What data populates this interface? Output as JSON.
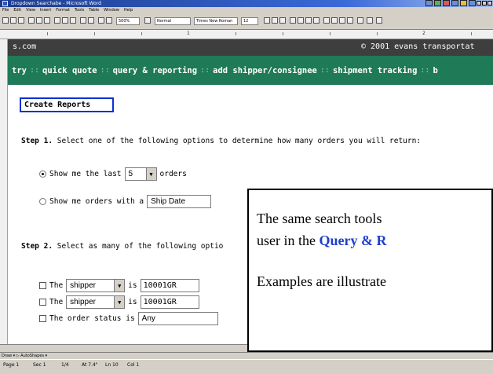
{
  "window": {
    "title": "Dropdown Searchabe - Microsoft Word"
  },
  "menu": [
    "File",
    "Edit",
    "View",
    "Insert",
    "Format",
    "Tools",
    "Table",
    "Window",
    "Help"
  ],
  "toolbar": {
    "zoom": "500%",
    "style": "Normal",
    "font": "Times New Roman",
    "size": "12"
  },
  "ruler": {
    "marks": [
      "1",
      "2"
    ]
  },
  "web": {
    "url": "s.com",
    "copyright": "© 2001 evans transportat",
    "nav_sep": "::",
    "nav": [
      "try",
      "quick quote",
      "query & reporting",
      "add shipper/consignee",
      "shipment tracking",
      "b"
    ]
  },
  "form": {
    "title": "Create Reports",
    "step1": {
      "label": "Step 1.",
      "text": " Select one of the following options to determine how many orders you will return:"
    },
    "opt1": {
      "prefix": "Show me the last",
      "value": "5",
      "suffix": "orders"
    },
    "opt2": {
      "prefix": "Show me orders with a",
      "value": "Ship Date"
    },
    "step2": {
      "label": "Step 2.",
      "text": " Select as many of the following optio"
    },
    "filters": [
      {
        "lead": "The",
        "field": "shipper",
        "is": "is",
        "value": "10001GR"
      },
      {
        "lead": "The",
        "field": "shipper",
        "is": "is",
        "value": "10001GR"
      }
    ],
    "status": {
      "lead": "The order status is",
      "value": "Any"
    }
  },
  "callout": {
    "line1": "The same search tools",
    "line2_pre": "user in the ",
    "line2_hl": "Query & R",
    "line3": "Examples are illustrate"
  },
  "drawbar": {
    "text": "Draw ▾  ▷  AutoShapes ▾"
  },
  "status": {
    "page": "Page 1",
    "sec": "Sec 1",
    "pages": "1/4",
    "at": "At 7.4\"",
    "ln": "Ln 10",
    "col": "Col 1"
  }
}
